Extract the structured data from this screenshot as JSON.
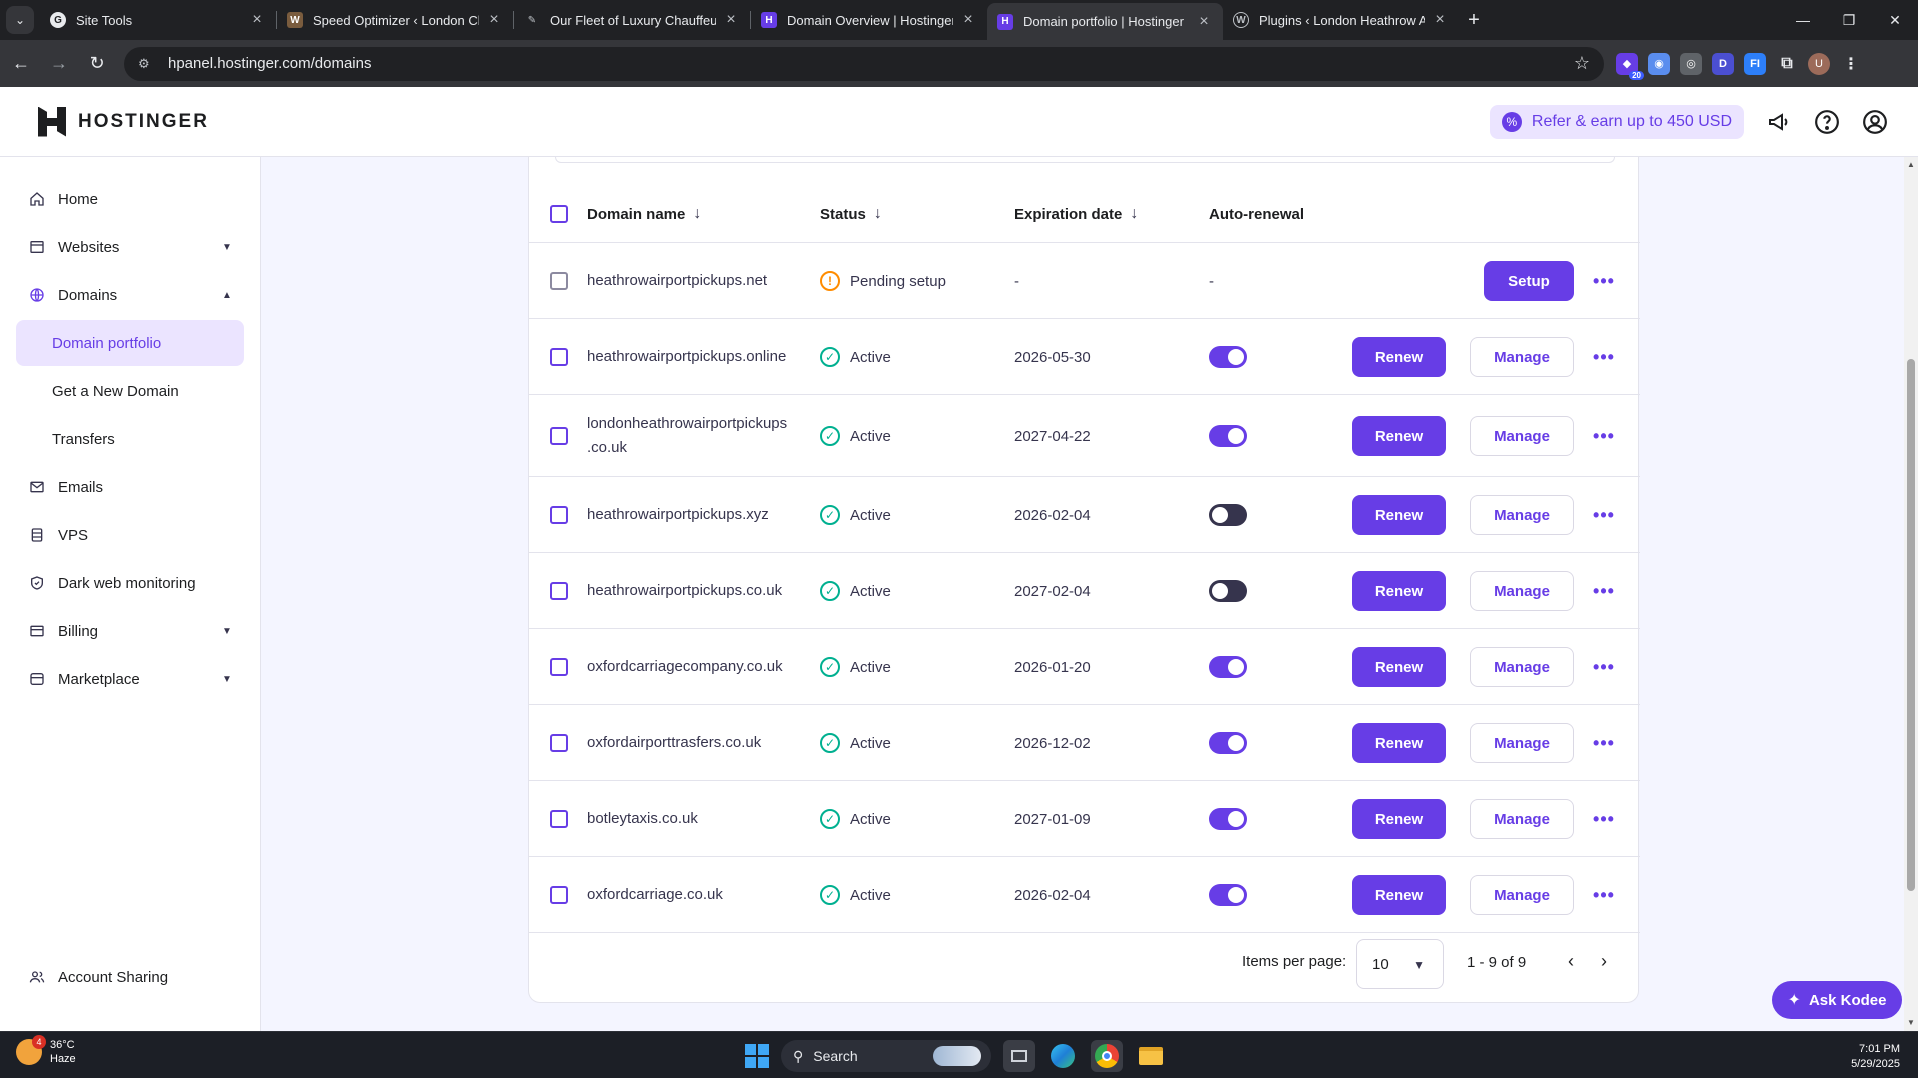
{
  "browser": {
    "tabs": [
      {
        "title": "Site Tools",
        "active": false
      },
      {
        "title": "Speed Optimizer ‹ London Cha",
        "active": false
      },
      {
        "title": "Our Fleet of Luxury Chauffeur C",
        "active": false
      },
      {
        "title": "Domain Overview | Hostinger",
        "active": false
      },
      {
        "title": "Domain portfolio | Hostinger",
        "active": true
      },
      {
        "title": "Plugins ‹ London Heathrow Air",
        "active": false
      }
    ],
    "url": "hpanel.hostinger.com/domains",
    "ext_badge": "20",
    "profile_initial": "U"
  },
  "header": {
    "brand": "HOSTINGER",
    "refer_label": "Refer & earn up to 450 USD"
  },
  "sidebar": {
    "items": [
      {
        "label": "Home",
        "icon": "home-icon"
      },
      {
        "label": "Websites",
        "icon": "browser-icon"
      },
      {
        "label": "Domains",
        "icon": "globe-icon"
      },
      {
        "label": "Domain portfolio"
      },
      {
        "label": "Get a New Domain"
      },
      {
        "label": "Transfers"
      },
      {
        "label": "Emails",
        "icon": "mail-icon"
      },
      {
        "label": "VPS",
        "icon": "server-icon"
      },
      {
        "label": "Dark web monitoring",
        "icon": "shield-icon"
      },
      {
        "label": "Billing",
        "icon": "card-icon"
      },
      {
        "label": "Marketplace",
        "icon": "store-icon"
      }
    ],
    "account_sharing": "Account Sharing"
  },
  "table": {
    "headers": {
      "domain": "Domain name",
      "status": "Status",
      "expiration": "Expiration date",
      "auto_renewal": "Auto-renewal"
    },
    "rows": [
      {
        "domain": "heathrowairportpickups.net",
        "status": "Pending setup",
        "expiration": "-",
        "auto": "-",
        "action": "Setup"
      },
      {
        "domain": "heathrowairportpickups.online",
        "status": "Active",
        "expiration": "2026-05-30",
        "auto_on": true
      },
      {
        "domain": "londonheathrowairportpickups.co.uk",
        "domain_line1": "londonheathrowairportpickups",
        "domain_line2": ".co.uk",
        "status": "Active",
        "expiration": "2027-04-22",
        "auto_on": true
      },
      {
        "domain": "heathrowairportpickups.xyz",
        "status": "Active",
        "expiration": "2026-02-04",
        "auto_on": false
      },
      {
        "domain": "heathrowairportpickups.co.uk",
        "status": "Active",
        "expiration": "2027-02-04",
        "auto_on": false
      },
      {
        "domain": "oxfordcarriagecompany.co.uk",
        "status": "Active",
        "expiration": "2026-01-20",
        "auto_on": true
      },
      {
        "domain": "oxfordairporttrasfers.co.uk",
        "status": "Active",
        "expiration": "2026-12-02",
        "auto_on": true
      },
      {
        "domain": "botleytaxis.co.uk",
        "status": "Active",
        "expiration": "2027-01-09",
        "auto_on": true
      },
      {
        "domain": "oxfordcarriage.co.uk",
        "status": "Active",
        "expiration": "2026-02-04",
        "auto_on": true
      }
    ],
    "renew_label": "Renew",
    "manage_label": "Manage"
  },
  "pagination": {
    "items_per_page_label": "Items per page:",
    "items_per_page": "10",
    "range": "1 - 9 of 9"
  },
  "ask_kodee": "Ask Kodee",
  "taskbar": {
    "temperature": "36°C",
    "weather": "Haze",
    "weather_badge": "4",
    "search": "Search",
    "time": "7:01 PM",
    "date": "5/29/2025"
  },
  "colors": {
    "brand": "#673de6",
    "active_status": "#00b090",
    "pending_status": "#ff8c00"
  }
}
